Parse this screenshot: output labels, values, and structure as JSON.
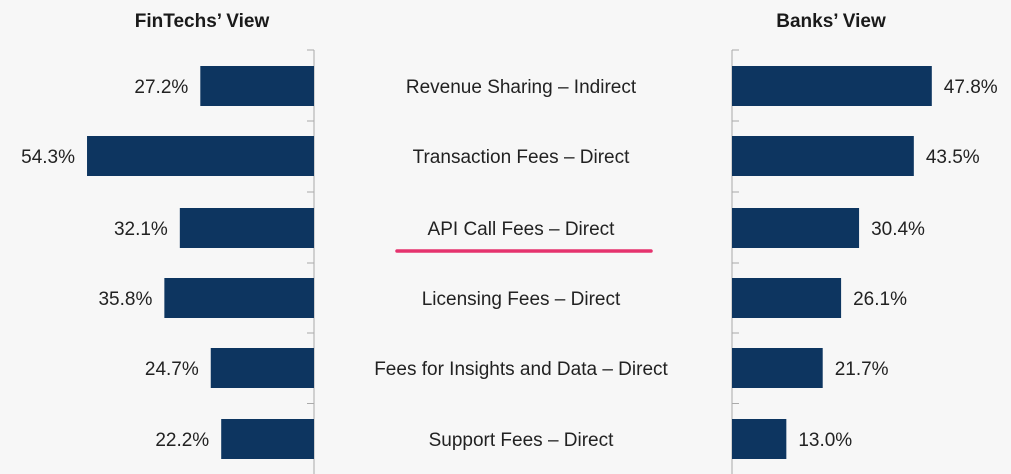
{
  "chart_data": {
    "type": "bar",
    "categories": [
      "Revenue Sharing – Indirect",
      "Transaction Fees – Direct",
      "API Call Fees – Direct",
      "Licensing Fees – Direct",
      "Fees for Insights and Data – Direct",
      "Support Fees – Direct"
    ],
    "series": [
      {
        "name": "FinTechs’ View",
        "values": [
          27.2,
          54.3,
          32.1,
          35.8,
          24.7,
          22.2
        ],
        "labels": [
          "27.2%",
          "54.3%",
          "32.1%",
          "35.8%",
          "24.7%",
          "22.2%"
        ],
        "direction": "left"
      },
      {
        "name": "Banks’ View",
        "values": [
          47.8,
          43.5,
          30.4,
          26.1,
          21.7,
          13.0
        ],
        "labels": [
          "47.8%",
          "43.5%",
          "30.4%",
          "26.1%",
          "21.7%",
          "13.0%"
        ],
        "direction": "right"
      }
    ],
    "value_unit": "%",
    "highlighted_category": "API Call Fees – Direct",
    "grid": false,
    "colors": {
      "bar": "#0d3560",
      "highlight_underline": "#e5336e",
      "axis": "#aaaaaa",
      "text": "#222222",
      "background": "#f7f7f7"
    }
  }
}
